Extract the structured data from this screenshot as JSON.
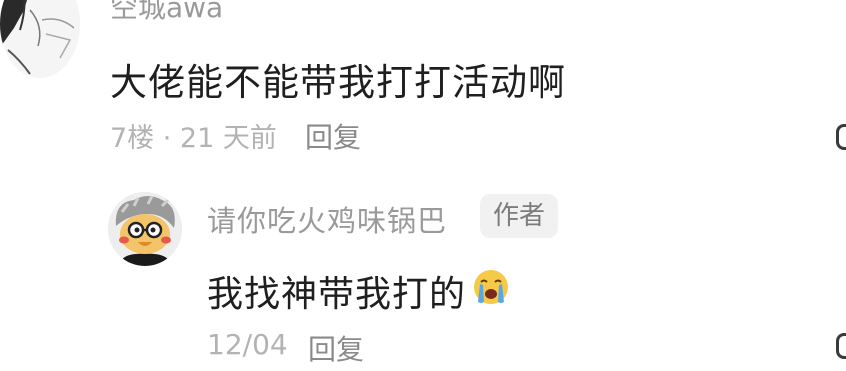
{
  "comment": {
    "username": "空城awa",
    "content": "大佬能不能带我打打活动啊",
    "meta": "7楼 · 21 天前",
    "reply_label": "回复",
    "avatar_icon": "sketch-girl-avatar",
    "like_icon": "thumb-up-icon"
  },
  "reply": {
    "username": "请你吃火鸡味锅巴",
    "badge": "作者",
    "content": "我找神带我打的",
    "emoji_icon": "crying-face-emoji",
    "time": "12/04",
    "reply_label": "回复",
    "avatar_icon": "cartoon-duck-avatar",
    "like_icon": "thumb-up-icon"
  },
  "colors": {
    "text_primary": "#1f1f1f",
    "text_secondary": "#9a9a9a",
    "text_meta": "#b3b3b3",
    "badge_bg": "#f1f1f1",
    "emoji_yellow": "#f7c948",
    "emoji_tear": "#5aa7e8"
  }
}
